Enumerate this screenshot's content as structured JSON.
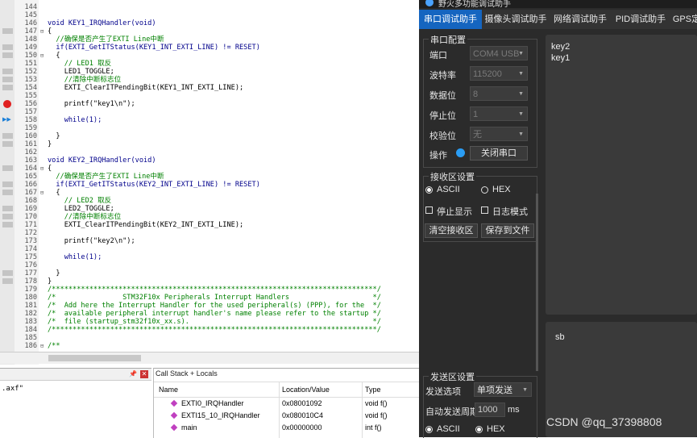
{
  "editor": {
    "lines": [
      {
        "n": "144",
        "fold": "",
        "text": "",
        "cls": ""
      },
      {
        "n": "145",
        "fold": "",
        "text": "",
        "cls": ""
      },
      {
        "n": "146",
        "fold": "",
        "text": "void KEY1_IRQHandler(void)",
        "cls": "kw"
      },
      {
        "n": "147",
        "fold": "⊟",
        "text": "{",
        "cls": ""
      },
      {
        "n": "148",
        "fold": "",
        "text": "  //确保是否产生了EXTI Line中断",
        "cls": "comment"
      },
      {
        "n": "149",
        "fold": "",
        "text": "  if(EXTI_GetITStatus(KEY1_INT_EXTI_LINE) != RESET)",
        "cls": "kw"
      },
      {
        "n": "150",
        "fold": "⊟",
        "text": "  {",
        "cls": ""
      },
      {
        "n": "151",
        "fold": "",
        "text": "    // LED1 取反",
        "cls": "comment"
      },
      {
        "n": "152",
        "fold": "",
        "text": "    LED1_TOGGLE;",
        "cls": ""
      },
      {
        "n": "153",
        "fold": "",
        "text": "    //清除中断标志位",
        "cls": "comment"
      },
      {
        "n": "154",
        "fold": "",
        "text": "    EXTI_ClearITPendingBit(KEY1_INT_EXTI_LINE);",
        "cls": ""
      },
      {
        "n": "155",
        "fold": "",
        "text": "",
        "cls": ""
      },
      {
        "n": "156",
        "fold": "",
        "text": "    printf(\"key1\\n\");",
        "cls": ""
      },
      {
        "n": "157",
        "fold": "",
        "text": "",
        "cls": ""
      },
      {
        "n": "158",
        "fold": "",
        "text": "    while(1);",
        "cls": "kw"
      },
      {
        "n": "159",
        "fold": "",
        "text": "",
        "cls": ""
      },
      {
        "n": "160",
        "fold": "",
        "text": "  }",
        "cls": ""
      },
      {
        "n": "161",
        "fold": "",
        "text": "}",
        "cls": ""
      },
      {
        "n": "162",
        "fold": "",
        "text": "",
        "cls": ""
      },
      {
        "n": "163",
        "fold": "",
        "text": "void KEY2_IRQHandler(void)",
        "cls": "kw"
      },
      {
        "n": "164",
        "fold": "⊟",
        "text": "{",
        "cls": ""
      },
      {
        "n": "165",
        "fold": "",
        "text": "  //确保是否产生了EXTI Line中断",
        "cls": "comment"
      },
      {
        "n": "166",
        "fold": "",
        "text": "  if(EXTI_GetITStatus(KEY2_INT_EXTI_LINE) != RESET)",
        "cls": "kw"
      },
      {
        "n": "167",
        "fold": "⊟",
        "text": "  {",
        "cls": ""
      },
      {
        "n": "168",
        "fold": "",
        "text": "    // LED2 取反",
        "cls": "comment"
      },
      {
        "n": "169",
        "fold": "",
        "text": "    LED2_TOGGLE;",
        "cls": ""
      },
      {
        "n": "170",
        "fold": "",
        "text": "    //清除中断标志位",
        "cls": "comment"
      },
      {
        "n": "171",
        "fold": "",
        "text": "    EXTI_ClearITPendingBit(KEY2_INT_EXTI_LINE);",
        "cls": ""
      },
      {
        "n": "172",
        "fold": "",
        "text": "",
        "cls": ""
      },
      {
        "n": "173",
        "fold": "",
        "text": "    printf(\"key2\\n\");",
        "cls": ""
      },
      {
        "n": "174",
        "fold": "",
        "text": "",
        "cls": ""
      },
      {
        "n": "175",
        "fold": "",
        "text": "    while(1);",
        "cls": "kw"
      },
      {
        "n": "176",
        "fold": "",
        "text": "",
        "cls": ""
      },
      {
        "n": "177",
        "fold": "",
        "text": "  }",
        "cls": ""
      },
      {
        "n": "178",
        "fold": "",
        "text": "}",
        "cls": ""
      },
      {
        "n": "179",
        "fold": "",
        "text": "/******************************************************************************/",
        "cls": "comment"
      },
      {
        "n": "180",
        "fold": "",
        "text": "/*                STM32F10x Peripherals Interrupt Handlers                    */",
        "cls": "comment"
      },
      {
        "n": "181",
        "fold": "",
        "text": "/*  Add here the Interrupt Handler for the used peripheral(s) (PPP), for the  */",
        "cls": "comment"
      },
      {
        "n": "182",
        "fold": "",
        "text": "/*  available peripheral interrupt handler's name please refer to the startup */",
        "cls": "comment"
      },
      {
        "n": "183",
        "fold": "",
        "text": "/*  file (startup_stm32f10x_xx.s).                                            */",
        "cls": "comment"
      },
      {
        "n": "184",
        "fold": "",
        "text": "/******************************************************************************/",
        "cls": "comment"
      },
      {
        "n": "185",
        "fold": "",
        "text": "",
        "cls": ""
      },
      {
        "n": "186",
        "fold": "⊟",
        "text": "/**",
        "cls": "comment"
      }
    ]
  },
  "build_output": {
    "text": ".axf\"",
    "pin": "📌",
    "close": "✕"
  },
  "callstack": {
    "title": "Call Stack + Locals",
    "headers": [
      "Name",
      "Location/Value",
      "Type"
    ],
    "rows": [
      {
        "name": "EXTI0_IRQHandler",
        "loc": "0x08001092",
        "type": "void f()"
      },
      {
        "name": "EXTI15_10_IRQHandler",
        "loc": "0x080010C4",
        "type": "void f()"
      },
      {
        "name": "main",
        "loc": "0x00000000",
        "type": "int f()"
      }
    ]
  },
  "tool": {
    "title": "野火多功能调试助手",
    "tabs": [
      "串口调试助手",
      "摄像头调试助手",
      "网络调试助手",
      "PID调试助手",
      "GPS定"
    ],
    "serial_cfg": {
      "title": "串口配置",
      "port_label": "端口",
      "port_value": "COM4 USB",
      "baud_label": "波特率",
      "baud_value": "115200",
      "data_label": "数据位",
      "data_value": "8",
      "stop_label": "停止位",
      "stop_value": "1",
      "parity_label": "校验位",
      "parity_value": "无",
      "op_label": "操作",
      "close_btn": "关闭串口"
    },
    "recv_cfg": {
      "title": "接收区设置",
      "ascii": "ASCII",
      "hex": "HEX",
      "stop_display": "停止显示",
      "log_mode": "日志模式",
      "clear_btn": "清空接收区",
      "save_btn": "保存到文件"
    },
    "recv_lines": [
      "key2",
      "key1"
    ],
    "send_text": "sb",
    "send_cfg": {
      "title": "发送区设置",
      "opt_label": "发送选项",
      "opt_value": "单项发送",
      "period_label": "自动发送周期",
      "period_value": "1000",
      "period_unit": "ms",
      "ascii": "ASCII",
      "hex": "HEX"
    },
    "watermark": "CSDN @qq_37398808"
  }
}
